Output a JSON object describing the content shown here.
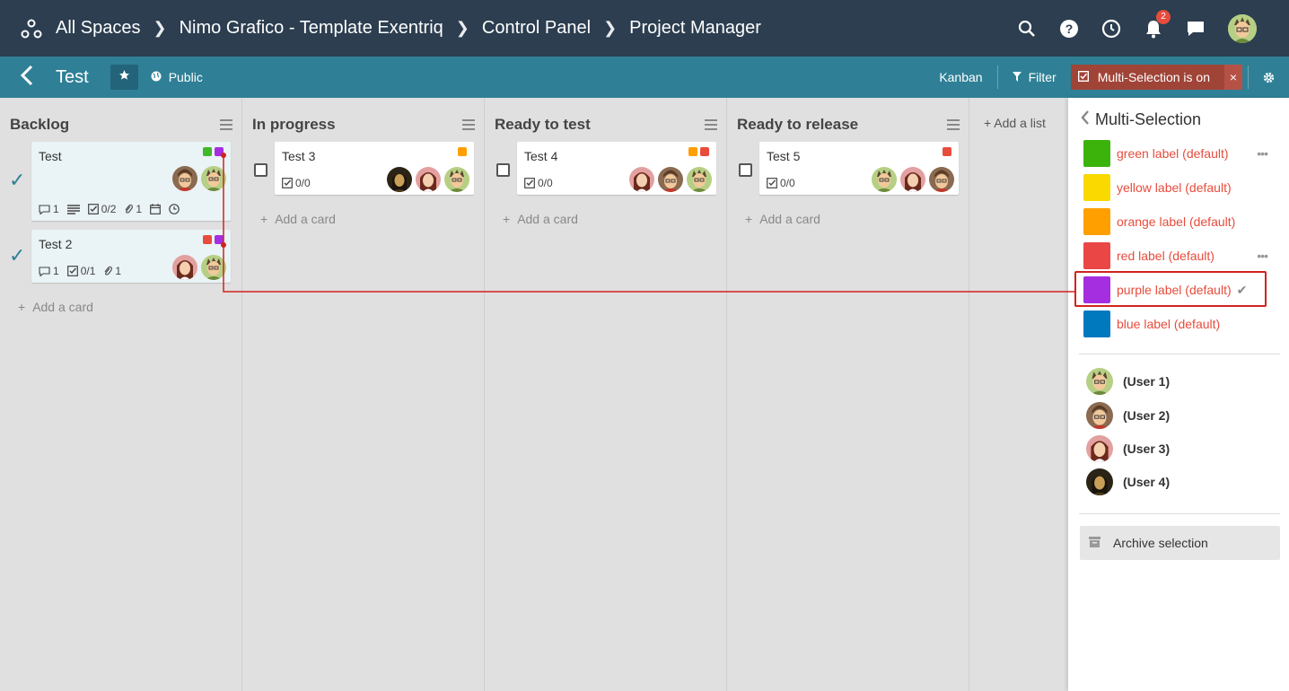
{
  "breadcrumbs": [
    "All Spaces",
    "Nimo Grafico - Template Exentriq",
    "Control Panel",
    "Project Manager"
  ],
  "notifications_count": "2",
  "board": {
    "title": "Test",
    "visibility": "Public",
    "view": "Kanban",
    "filter_label": "Filter",
    "multi_selection_label": "Multi-Selection is on",
    "close_glyph": "×",
    "add_list": "Add a list"
  },
  "lists": [
    {
      "title": "Backlog",
      "add_card": "Add a card",
      "cards": [
        {
          "title": "Test",
          "selected": true,
          "labels": [
            "#42b72a",
            "#a52fe0"
          ],
          "comments": "1",
          "checklist": "0/2",
          "attachments": "1",
          "has_description": true,
          "has_due": true,
          "has_time": true
        },
        {
          "title": "Test 2",
          "selected": true,
          "labels": [
            "#e74c3c",
            "#a52fe0"
          ],
          "comments": "1",
          "checklist": "0/1",
          "attachments": "1"
        }
      ]
    },
    {
      "title": "In progress",
      "add_card": "Add a card",
      "cards": [
        {
          "title": "Test 3",
          "selected": false,
          "labels": [
            "#ff9f00"
          ],
          "checklist": "0/0"
        }
      ]
    },
    {
      "title": "Ready to test",
      "add_card": "Add a card",
      "cards": [
        {
          "title": "Test 4",
          "selected": false,
          "labels": [
            "#ff9f00",
            "#e74c3c"
          ],
          "checklist": "0/0"
        }
      ]
    },
    {
      "title": "Ready to release",
      "add_card": "Add a card",
      "cards": [
        {
          "title": "Test 5",
          "selected": false,
          "labels": [
            "#e74c3c"
          ],
          "checklist": "0/0"
        }
      ]
    }
  ],
  "panel": {
    "title": "Multi-Selection",
    "labels": [
      {
        "name": "green label (default)",
        "color": "#3cb30a",
        "more": true
      },
      {
        "name": "yellow label (default)",
        "color": "#fad900"
      },
      {
        "name": "orange label (default)",
        "color": "#ff9f00"
      },
      {
        "name": "red label (default)",
        "color": "#eb4646",
        "more": true
      },
      {
        "name": "purple label (default)",
        "color": "#a52fe0",
        "checked": true
      },
      {
        "name": "blue label (default)",
        "color": "#0079bf"
      }
    ],
    "users": [
      "(User 1)",
      "(User 2)",
      "(User 3)",
      "(User 4)"
    ],
    "archive_label": "Archive selection"
  },
  "colors": {
    "header": "#2c3e50",
    "subheader": "#2f8096",
    "highlight": "#d0231d"
  }
}
